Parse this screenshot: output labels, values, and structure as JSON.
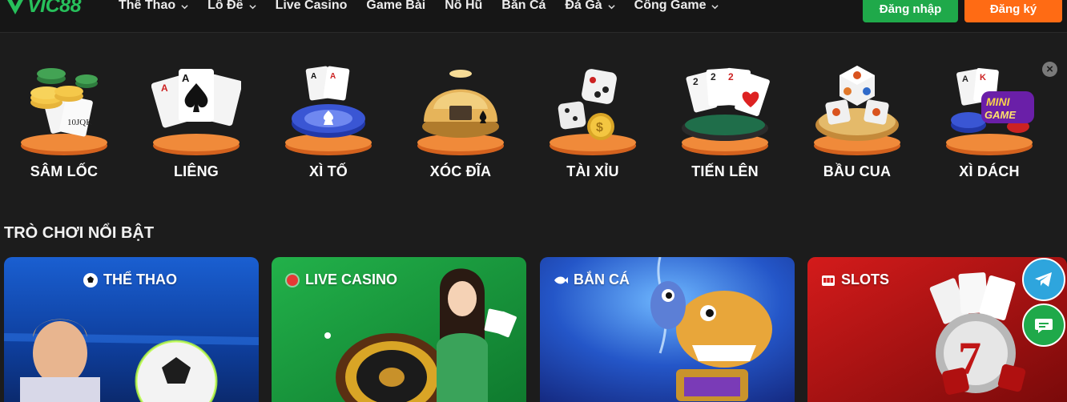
{
  "brand": {
    "logo_text": "VIC88",
    "accent": "#27c05b"
  },
  "nav": {
    "items": [
      {
        "label": "Thể Thao",
        "dropdown": true
      },
      {
        "label": "Lô Đề",
        "dropdown": true
      },
      {
        "label": "Live Casino",
        "dropdown": false
      },
      {
        "label": "Game Bài",
        "dropdown": false
      },
      {
        "label": "Nổ Hũ",
        "dropdown": false
      },
      {
        "label": "Bắn Cá",
        "dropdown": false
      },
      {
        "label": "Đá Gà",
        "dropdown": true
      },
      {
        "label": "Cổng Game",
        "dropdown": true
      }
    ]
  },
  "auth": {
    "login_label": "Đăng nhập",
    "register_label": "Đăng ký",
    "login_color": "#1fa94a",
    "register_color": "#ff6b14"
  },
  "games": [
    {
      "label": "SÂM LỐC",
      "icon": "chips-cards-icon"
    },
    {
      "label": "LIÊNG",
      "icon": "spade-cards-icon"
    },
    {
      "label": "XÌ TỐ",
      "icon": "poker-chip-icon"
    },
    {
      "label": "XÓC ĐĨA",
      "icon": "bowl-plate-icon"
    },
    {
      "label": "TÀI XỈU",
      "icon": "dice-coin-icon"
    },
    {
      "label": "TIẾN LÊN",
      "icon": "playing-cards-table-icon"
    },
    {
      "label": "BẦU CUA",
      "icon": "crab-dice-icon"
    },
    {
      "label": "XÌ DÁCH",
      "icon": "mini-game-icon",
      "badge": "MINI GAME"
    }
  ],
  "featured": {
    "title": "TRÒ CHƠI NỔI BẬT",
    "cards": [
      {
        "label": "THỂ THAO",
        "icon": "soccer-ball-icon"
      },
      {
        "label": "LIVE CASINO",
        "icon": "live-dot-icon"
      },
      {
        "label": "BẮN CÁ",
        "icon": "fish-icon"
      },
      {
        "label": "SLOTS",
        "icon": "slot-machine-icon"
      }
    ]
  },
  "floating": {
    "telegram_icon": "telegram-icon",
    "chat_icon": "chat-icon"
  }
}
